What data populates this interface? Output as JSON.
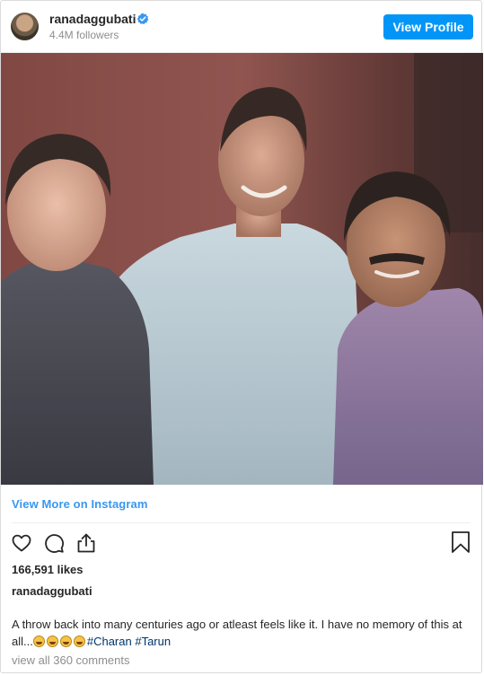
{
  "header": {
    "username": "ranadaggubati",
    "followers": "4.4M followers",
    "view_profile_label": "View Profile"
  },
  "post": {
    "view_more_label": "View More on Instagram",
    "likes": "166,591 likes",
    "caption_user": "ranadaggubati",
    "caption_text": "A throw back into many centuries ago or atleast feels like it. I have no memory of this at all...",
    "emoji_count": 4,
    "hashtags": [
      "#Charan",
      "#Tarun"
    ],
    "comments_link": "view all 360 comments"
  },
  "icons": {
    "verified": "verified-badge-icon",
    "like": "heart-icon",
    "comment": "comment-icon",
    "share": "share-icon",
    "save": "bookmark-icon"
  },
  "colors": {
    "brand_blue": "#0095f6",
    "link_blue": "#3897f0",
    "hashtag": "#003569",
    "muted": "#8e8e8e"
  }
}
